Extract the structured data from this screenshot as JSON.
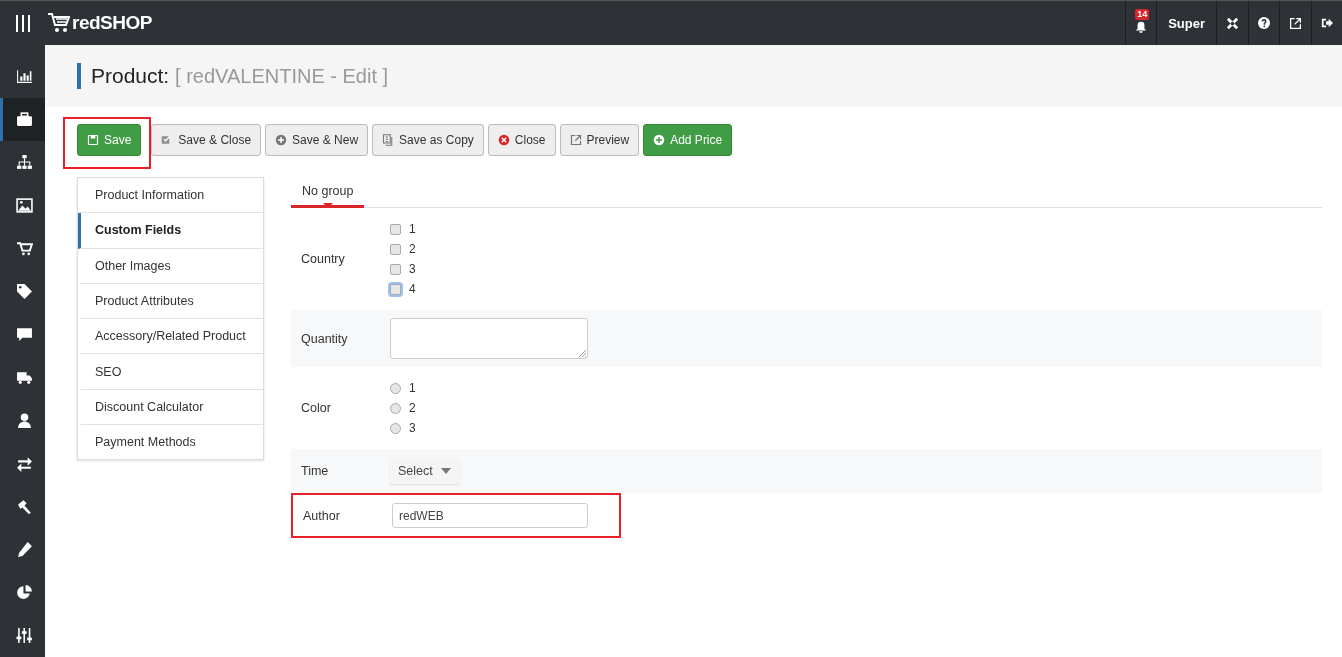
{
  "topbar": {
    "brand": "redSHOP",
    "notification_count": "14",
    "user": "Super"
  },
  "sidebar": {
    "items": [
      {
        "selected": false
      },
      {
        "selected": true
      },
      {
        "selected": false
      },
      {
        "selected": false
      },
      {
        "selected": false
      },
      {
        "selected": false
      },
      {
        "selected": false
      },
      {
        "selected": false
      },
      {
        "selected": false
      },
      {
        "selected": false
      },
      {
        "selected": false
      },
      {
        "selected": false
      },
      {
        "selected": false
      },
      {
        "selected": false
      }
    ]
  },
  "page_title": {
    "label": "Product:",
    "subtitle": "[ redVALENTINE - Edit ]"
  },
  "toolbar": [
    {
      "label": "Save",
      "kind": "primary",
      "highlighted": true
    },
    {
      "label": "Save & Close",
      "kind": "default",
      "highlighted": false
    },
    {
      "label": "Save & New",
      "kind": "default",
      "highlighted": false
    },
    {
      "label": "Save as Copy",
      "kind": "default",
      "highlighted": false
    },
    {
      "label": "Close",
      "kind": "default",
      "highlighted": false
    },
    {
      "label": "Preview",
      "kind": "default",
      "highlighted": false
    },
    {
      "label": "Add Price",
      "kind": "primary",
      "highlighted": false
    }
  ],
  "side_tabs": [
    {
      "label": "Product Information",
      "selected": false
    },
    {
      "label": "Custom Fields",
      "selected": true
    },
    {
      "label": "Other Images",
      "selected": false
    },
    {
      "label": "Product Attributes",
      "selected": false
    },
    {
      "label": "Accessory/Related Product",
      "selected": false
    },
    {
      "label": "SEO",
      "selected": false
    },
    {
      "label": "Discount Calculator",
      "selected": false
    },
    {
      "label": "Payment Methods",
      "selected": false
    }
  ],
  "group_tabs": [
    {
      "label": "No group",
      "selected": true
    }
  ],
  "fields": [
    {
      "label": "Country",
      "kind": "checkboxes",
      "highlighted": false,
      "options": [
        {
          "label": "1",
          "checked": false,
          "focused": false
        },
        {
          "label": "2",
          "checked": false,
          "focused": false
        },
        {
          "label": "3",
          "checked": false,
          "focused": false
        },
        {
          "label": "4",
          "checked": false,
          "focused": true
        }
      ]
    },
    {
      "label": "Quantity",
      "kind": "textarea",
      "highlighted": false
    },
    {
      "label": "Color",
      "kind": "radios",
      "highlighted": false,
      "options": [
        {
          "label": "1",
          "checked": false,
          "focused": false
        },
        {
          "label": "2",
          "checked": false,
          "focused": false
        },
        {
          "label": "3",
          "checked": false,
          "focused": false
        }
      ]
    },
    {
      "label": "Time",
      "kind": "select",
      "highlighted": false,
      "value": "Select"
    },
    {
      "label": "Author",
      "kind": "text",
      "highlighted": true,
      "value": "redWEB"
    }
  ]
}
